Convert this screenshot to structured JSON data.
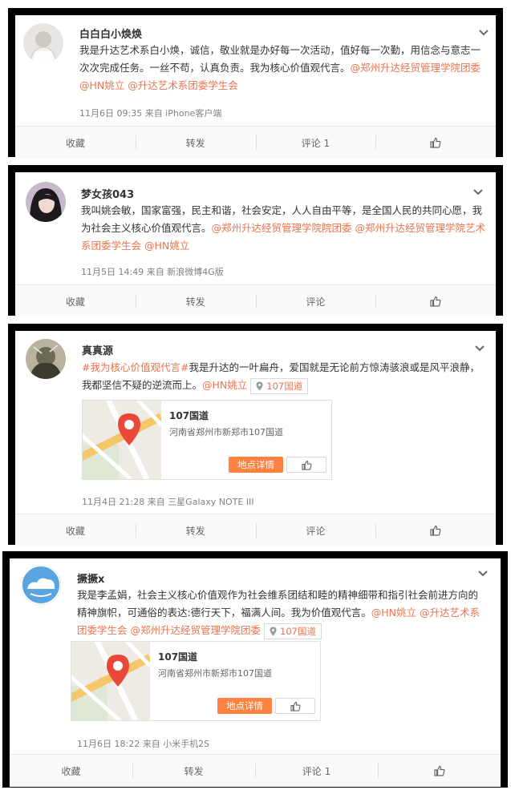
{
  "posts": [
    {
      "username": "白白白小焕焕",
      "text": [
        {
          "t": "我是升达艺术系白小焕，诚信，敬业就是办好每一次活动，值好每一次勤，用信念与意志一次次完成任务。一丝不苟，认真负责。我为核心价值观代言。",
          "link": false
        },
        {
          "t": "@郑州升达经贸管理学院团委",
          "link": true
        },
        {
          "t": " ",
          "link": false
        },
        {
          "t": "@HN姚立",
          "link": true
        },
        {
          "t": " ",
          "link": false
        },
        {
          "t": "@升达艺术系团委学生会",
          "link": true
        }
      ],
      "meta": "11月6日 09:35 来自 iPhone客户端",
      "actions": {
        "collect": "收藏",
        "repost": "转发",
        "comment": "评论 1"
      }
    },
    {
      "username": "梦女孩043",
      "text": [
        {
          "t": "我叫姚会敏，国家富强，民主和谐，社会安定，人人自由平等，是全国人民的共同心愿，我为社会主义核心价值观代言。",
          "link": false
        },
        {
          "t": "@郑州升达经贸管理学院院团委",
          "link": true
        },
        {
          "t": " ",
          "link": false
        },
        {
          "t": "@郑州升达经贸管理学院艺术系团委学生会",
          "link": true
        },
        {
          "t": " ",
          "link": false
        },
        {
          "t": "@HN姚立",
          "link": true
        }
      ],
      "meta": "11月5日 14:49 来自 新浪微博4G版",
      "actions": {
        "collect": "收藏",
        "repost": "转发",
        "comment": "评论"
      }
    },
    {
      "username": "真真源",
      "text": [
        {
          "t": "#我为核心价值观代言#",
          "link": true
        },
        {
          "t": "我是升达的一叶扁舟，爱国就是无论前方惊涛骇浪或是风平浪静，我都坚信不疑的逆流而上。",
          "link": false
        },
        {
          "t": "@HN姚立",
          "link": true
        }
      ],
      "location_tag": "107国道",
      "place": {
        "name": "107国道",
        "address": "河南省郑州市新郑市107国道",
        "detail_button": "地点详情"
      },
      "meta": "11月4日 21:28 来自 三星Galaxy NOTE III",
      "actions": {
        "collect": "收藏",
        "repost": "转发",
        "comment": "评论"
      }
    },
    {
      "username": "撅撅x",
      "text": [
        {
          "t": "我是李孟娟，社会主义核心价值观作为社会维系团结和睦的精神细带和指引社会前进方向的精神旗帜，可通俗的表达:德行天下，福满人间。我为价值观代言。",
          "link": false
        },
        {
          "t": "@HN姚立",
          "link": true
        },
        {
          "t": " ",
          "link": false
        },
        {
          "t": "@升达艺术系团委学生会",
          "link": true
        },
        {
          "t": " ",
          "link": false
        },
        {
          "t": "@郑州升达经贸管理学院团委",
          "link": true
        }
      ],
      "location_tag": "107国道",
      "place": {
        "name": "107国道",
        "address": "河南省郑州市新郑市107国道",
        "detail_button": "地点详情"
      },
      "meta": "11月6日 18:22 来自 小米手机2S",
      "actions": {
        "collect": "收藏",
        "repost": "转发",
        "comment": "评论 1"
      }
    }
  ],
  "colors": {
    "link": "#eb7350",
    "detail_button": "#ff8140",
    "frame": "#000000"
  },
  "icons": [
    "chevron-down-icon",
    "thumbs-up-icon",
    "location-pin-icon",
    "map-pin-icon"
  ]
}
